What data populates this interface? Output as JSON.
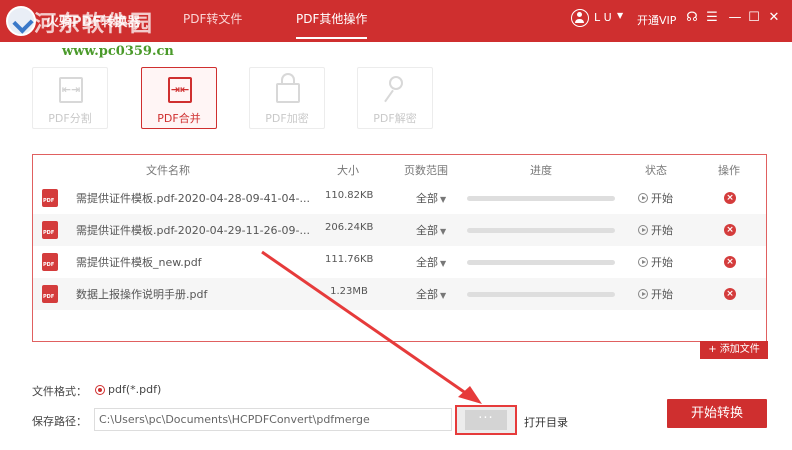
{
  "titlebar": {
    "app_title": "火骑PDF转换器",
    "watermark": "河东软件园",
    "watermark_url": "www.pc0359.cn",
    "tabs": [
      {
        "label": "PDF转文件",
        "active": false
      },
      {
        "label": "PDF其他操作",
        "active": true
      }
    ],
    "user": {
      "name": "L U"
    },
    "vip_label": "开通VIP",
    "icons": [
      "user-icon",
      "headset-icon",
      "menu-icon",
      "minimize-icon",
      "maximize-icon",
      "close-icon"
    ]
  },
  "tools": [
    {
      "label": "PDF分割",
      "icon": "split-icon",
      "active": false
    },
    {
      "label": "PDF合并",
      "icon": "merge-icon",
      "active": true
    },
    {
      "label": "PDF加密",
      "icon": "lock-icon",
      "active": false
    },
    {
      "label": "PDF解密",
      "icon": "key-icon",
      "active": false
    }
  ],
  "table": {
    "headers": {
      "name": "文件名称",
      "size": "大小",
      "range": "页数范围",
      "progress": "进度",
      "status": "状态",
      "action": "操作"
    },
    "rows": [
      {
        "name": "需提供证件模板.pdf-2020-04-28-09-41-04-...",
        "size": "110.82KB",
        "range": "全部",
        "status": "开始"
      },
      {
        "name": "需提供证件模板.pdf-2020-04-29-11-26-09-...",
        "size": "206.24KB",
        "range": "全部",
        "status": "开始"
      },
      {
        "name": "需提供证件模板_new.pdf",
        "size": "111.76KB",
        "range": "全部",
        "status": "开始"
      },
      {
        "name": "数据上报操作说明手册.pdf",
        "size": "1.23MB",
        "range": "全部",
        "status": "开始"
      }
    ],
    "add_file_label": "+ 添加文件"
  },
  "form": {
    "format_label": "文件格式：",
    "format_value": "pdf(*.pdf)",
    "path_label": "保存路径：",
    "path_value": "C:\\Users\\pc\\Documents\\HCPDFConvert\\pdfmerge",
    "browse_label": "···",
    "open_dir_label": "打开目录",
    "convert_label": "开始转换"
  },
  "colors": {
    "brand": "#cf2f2f",
    "annotation": "#e63b3b"
  }
}
